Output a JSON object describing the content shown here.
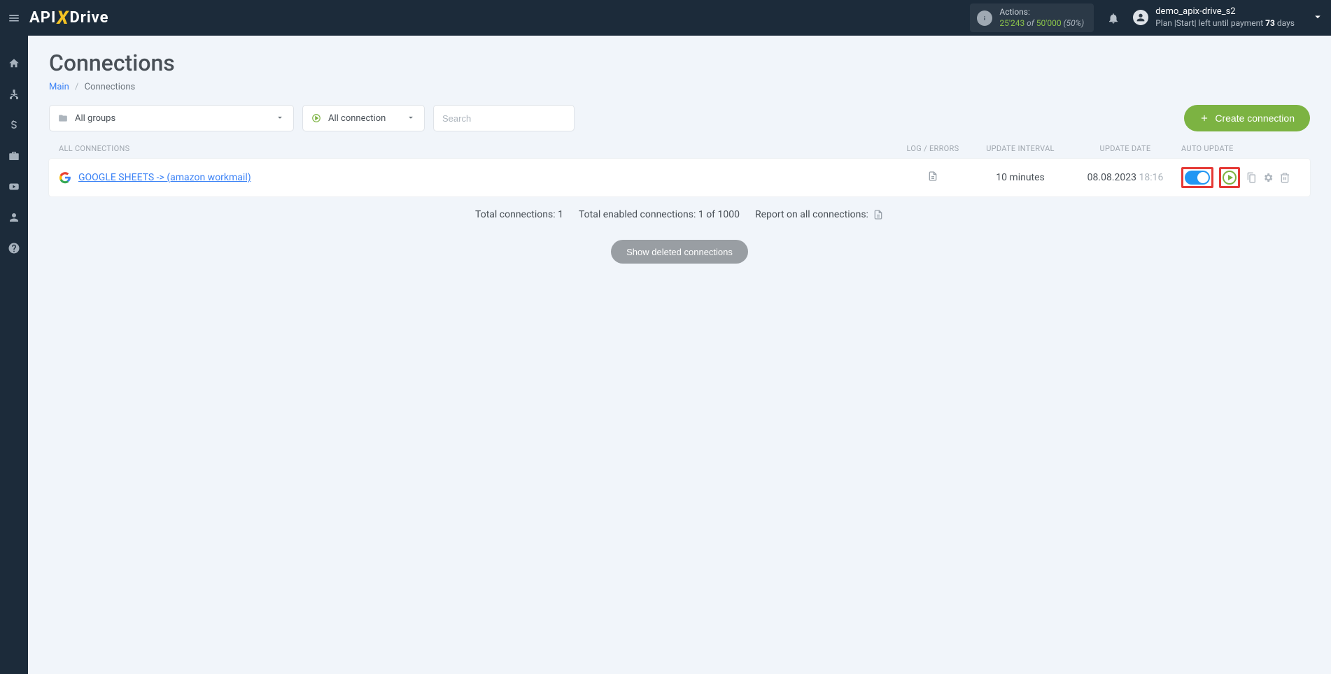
{
  "header": {
    "actions_label": "Actions:",
    "actions_used": "25'243",
    "actions_of": " of ",
    "actions_total": "50'000",
    "actions_pct": " (50%)",
    "user_name": "demo_apix-drive_s2",
    "plan_text_prefix": "Plan |Start| left until payment ",
    "plan_days": "73",
    "plan_days_suffix": " days"
  },
  "page": {
    "title": "Connections",
    "breadcrumb_main": "Main",
    "breadcrumb_current": "Connections"
  },
  "toolbar": {
    "groups_label": "All groups",
    "conn_filter_label": "All connection",
    "search_placeholder": "Search",
    "create_label": "Create connection"
  },
  "table": {
    "th_all": "ALL CONNECTIONS",
    "th_log": "LOG / ERRORS",
    "th_interval": "UPDATE INTERVAL",
    "th_date": "UPDATE DATE",
    "th_auto": "AUTO UPDATE"
  },
  "row": {
    "name": "GOOGLE SHEETS -> (amazon workmail)",
    "interval": "10 minutes",
    "date": "08.08.2023",
    "time": "18:16"
  },
  "summary": {
    "total_conn": "Total connections: 1",
    "total_enabled": "Total enabled connections: 1 of 1000",
    "report": "Report on all connections:"
  },
  "deleted_btn": "Show deleted connections"
}
